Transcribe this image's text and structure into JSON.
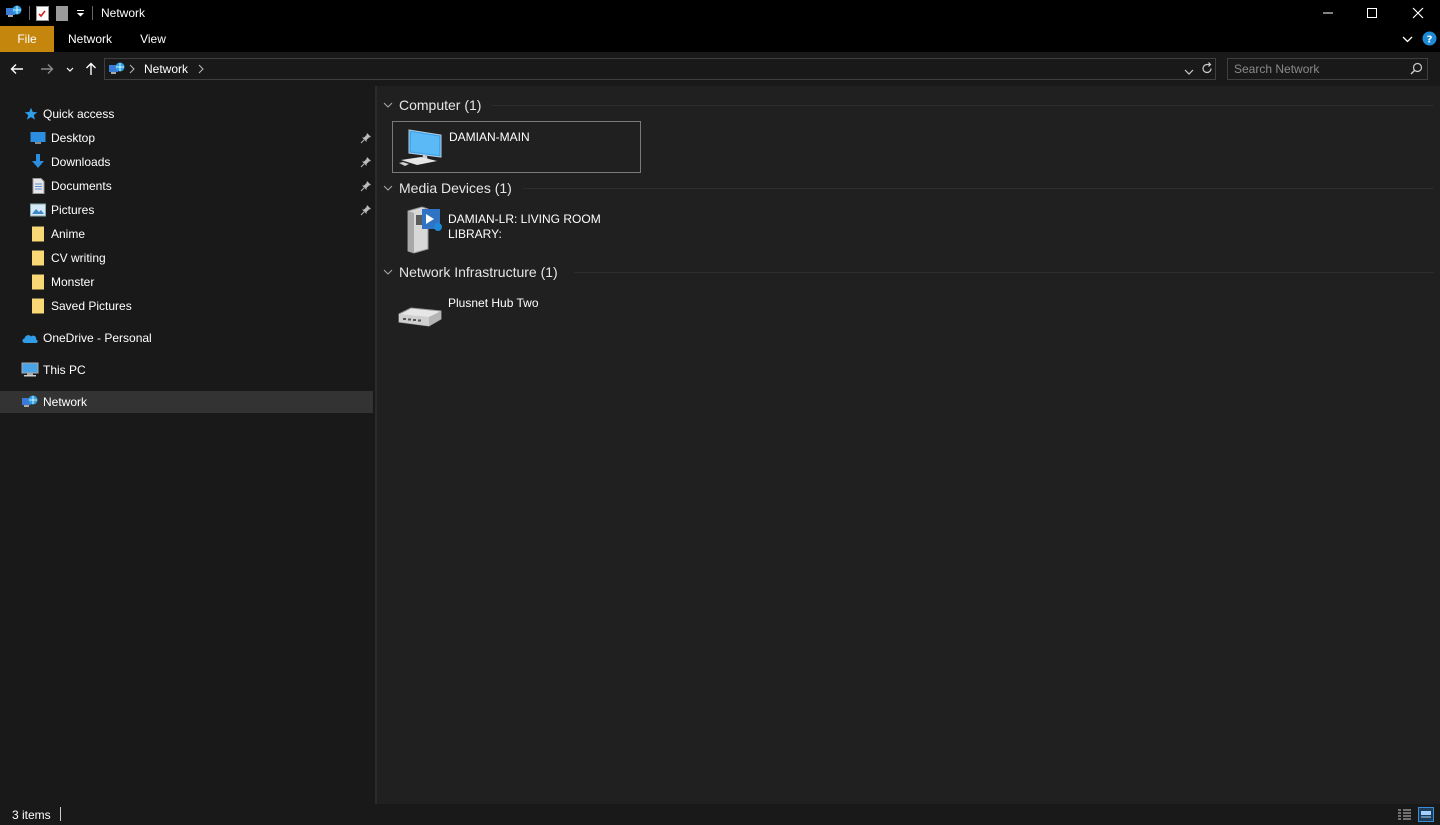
{
  "window": {
    "title": "Network",
    "controls": {
      "minimize": "minimize-icon",
      "maximize": "maximize-icon",
      "close": "close-icon"
    }
  },
  "ribbon": {
    "tabs": [
      {
        "label": "File",
        "active": true
      },
      {
        "label": "Network"
      },
      {
        "label": "View"
      }
    ]
  },
  "nav": {
    "breadcrumb": [
      "Network"
    ],
    "search_placeholder": "Search Network"
  },
  "sidebar": {
    "quick_access_label": "Quick access",
    "items": [
      {
        "label": "Desktop",
        "icon": "desktop-icon",
        "pinned": true
      },
      {
        "label": "Downloads",
        "icon": "download-icon",
        "pinned": true
      },
      {
        "label": "Documents",
        "icon": "document-icon",
        "pinned": true
      },
      {
        "label": "Pictures",
        "icon": "pictures-icon",
        "pinned": true
      },
      {
        "label": "Anime",
        "icon": "folder-icon"
      },
      {
        "label": "CV writing",
        "icon": "folder-icon"
      },
      {
        "label": "Monster",
        "icon": "folder-icon"
      },
      {
        "label": "Saved Pictures",
        "icon": "folder-icon"
      }
    ],
    "onedrive_label": "OneDrive - Personal",
    "thispc_label": "This PC",
    "network_label": "Network"
  },
  "groups": [
    {
      "header": "Computer (1)",
      "items": [
        {
          "name": "DAMIAN-MAIN",
          "icon": "computer-icon"
        }
      ]
    },
    {
      "header": "Media Devices (1)",
      "items": [
        {
          "name": "DAMIAN-LR: LIVING ROOM LIBRARY:",
          "icon": "media-server-icon"
        }
      ]
    },
    {
      "header": "Network Infrastructure (1)",
      "items": [
        {
          "name": "Plusnet Hub Two",
          "icon": "router-icon"
        }
      ]
    }
  ],
  "status": {
    "item_count": "3 items"
  },
  "colors": {
    "accent_file_tab": "#c4860c",
    "background": "#202020",
    "sidebar": "#191919",
    "selected": "#333333"
  }
}
